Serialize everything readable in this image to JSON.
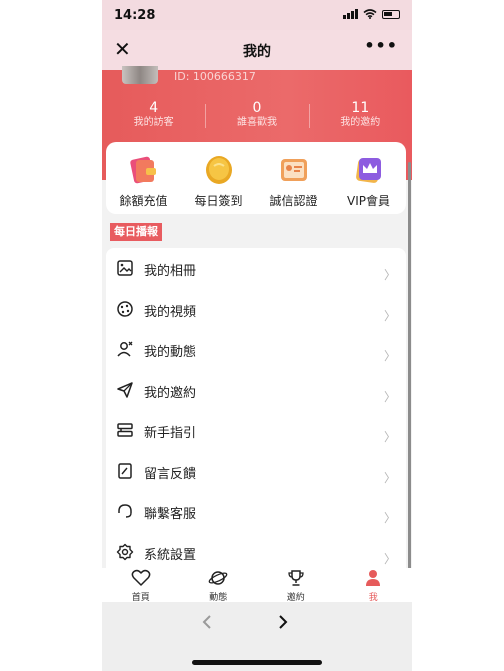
{
  "status_bar": {
    "time": "14:28"
  },
  "nav": {
    "close_glyph": "✕",
    "title": "我的",
    "more_glyph": "•••"
  },
  "profile": {
    "id_text": "ID: 100666317"
  },
  "stats": [
    {
      "value": "4",
      "label": "我的訪客"
    },
    {
      "value": "0",
      "label": "誰喜歡我"
    },
    {
      "value": "11",
      "label": "我的邀約"
    }
  ],
  "quick_menu": [
    {
      "label": "餘額充值",
      "icon": "wallet-icon"
    },
    {
      "label": "每日簽到",
      "icon": "coin-icon"
    },
    {
      "label": "誠信認證",
      "icon": "id-card-icon"
    },
    {
      "label": "VIP會員",
      "icon": "crown-icon"
    }
  ],
  "section_tag": "每日播報",
  "menu_list": [
    {
      "label": "我的相冊",
      "icon": "photo-album-icon"
    },
    {
      "label": "我的視頻",
      "icon": "video-icon"
    },
    {
      "label": "我的動態",
      "icon": "moments-icon"
    },
    {
      "label": "我的邀約",
      "icon": "send-icon"
    },
    {
      "label": "新手指引",
      "icon": "guide-icon"
    },
    {
      "label": "留言反饋",
      "icon": "feedback-icon"
    },
    {
      "label": "聯繫客服",
      "icon": "headset-icon"
    },
    {
      "label": "系統設置",
      "icon": "gear-icon"
    }
  ],
  "tabs": [
    {
      "label": "首頁",
      "icon": "heart-icon"
    },
    {
      "label": "動態",
      "icon": "planet-icon"
    },
    {
      "label": "邀約",
      "icon": "trophy-icon"
    },
    {
      "label": "我",
      "icon": "person-icon"
    }
  ],
  "browser": {
    "back_glyph": "‹",
    "forward_glyph": "›"
  },
  "colors": {
    "accent": "#e65b5b",
    "header_bg": "#eb6a6a",
    "nav_bg": "#f5dde2"
  }
}
